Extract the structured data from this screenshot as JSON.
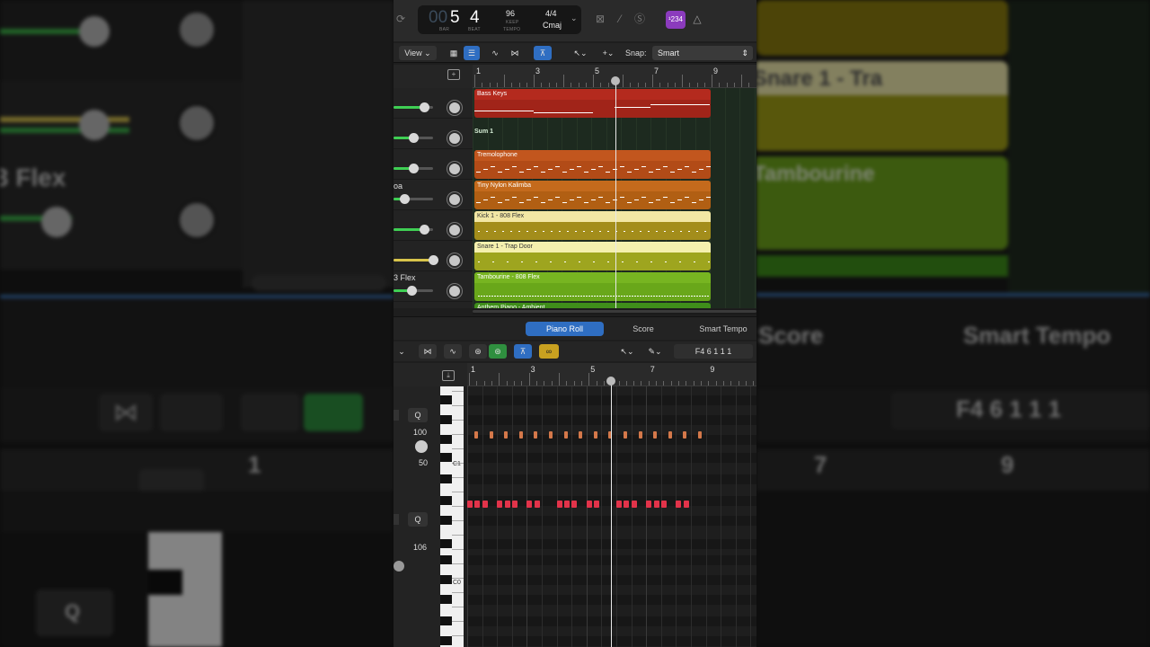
{
  "background": {
    "left": {
      "faders": [
        "",
        "",
        ""
      ],
      "label_flex": "3 Flex",
      "label_ambient": "Anthem Piano"
    },
    "right": {
      "snare": "Snare 1 - Tra",
      "tambourine": "Tambourine",
      "anthem": "Anthem Piano",
      "score": "Score",
      "smart_tempo": "Smart Tempo",
      "position": "F4   6 1 1 1",
      "bar7": "7",
      "bar9": "9"
    },
    "left_lower": {
      "bar1": "1",
      "q": "Q"
    }
  },
  "lcd": {
    "bar_dim": "00",
    "bar": "5",
    "beat": "4",
    "bar_cap": "BAR",
    "beat_cap": "BEAT",
    "tempo": "96",
    "keep": "KEEP",
    "tempo_cap": "TEMPO",
    "signature": "4/4",
    "key": "Cmaj"
  },
  "toolbar": {
    "count_in": "¹234"
  },
  "tracks": {
    "view_label": "View",
    "snap_label": "Snap:",
    "snap_value": "Smart",
    "ruler": [
      "1",
      "3",
      "5",
      "7",
      "9"
    ],
    "headers": [
      {
        "label": ""
      },
      {
        "label": ""
      },
      {
        "label": ""
      },
      {
        "label": "oa"
      },
      {
        "label": ""
      },
      {
        "label": ""
      },
      {
        "label": "3 Flex"
      }
    ],
    "regions": [
      {
        "name": "Bass Keys",
        "color": "#b42a1e",
        "body": "#a12419",
        "text": "#ffffff"
      },
      {
        "name": "Sum 1",
        "color": "#1d2a1f",
        "body": "#1d2a1f",
        "text": "#d8f0d8"
      },
      {
        "name": "Tremolophone",
        "color": "#c2561e",
        "body": "#b24b17",
        "text": "#ffffff"
      },
      {
        "name": "Tiny Nylon Kalimba",
        "color": "#c46a1c",
        "body": "#b15f13",
        "text": "#ffffff"
      },
      {
        "name": "Kick 1 - 808 Flex",
        "color": "#f2e7a4",
        "body": "#a38d1b",
        "text": "#333333"
      },
      {
        "name": "Snare 1 - Trap Door",
        "color": "#f4f0ae",
        "body": "#9ea51f",
        "text": "#333333"
      },
      {
        "name": "Tambourine - 808 Flex",
        "color": "#77b521",
        "body": "#69a71a",
        "text": "#ffffff"
      }
    ],
    "partial_region": "Anthem Piano - Ambient"
  },
  "tabs": {
    "piano_roll": "Piano Roll",
    "score": "Score",
    "smart_tempo": "Smart Tempo"
  },
  "piano_roll": {
    "position": "F4   6 1 1 1",
    "ruler": [
      "1",
      "3",
      "5",
      "7",
      "9"
    ],
    "q1": "Q",
    "q2": "Q",
    "vel1": "100",
    "vel2": "50",
    "vel3": "106",
    "c1": "C1",
    "c0": "C0"
  }
}
